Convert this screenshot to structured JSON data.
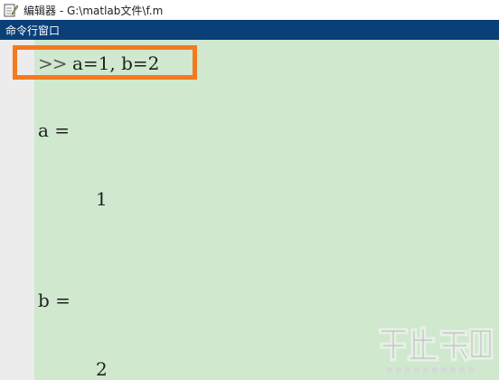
{
  "window": {
    "title": "编辑器 - G:\\matlab文件\\f.m",
    "title_icon": "editor-pencil-icon"
  },
  "panel": {
    "title": "命令行窗口"
  },
  "command_window": {
    "prompt": ">>",
    "command": "a=1, b=2",
    "output": [
      {
        "label": "a =",
        "value": "1"
      },
      {
        "label": "b =",
        "value": "2"
      }
    ]
  },
  "colors": {
    "command_bg": "#cfe8ce",
    "panel_bar": "#0a3f77",
    "highlight": "#f47920"
  }
}
